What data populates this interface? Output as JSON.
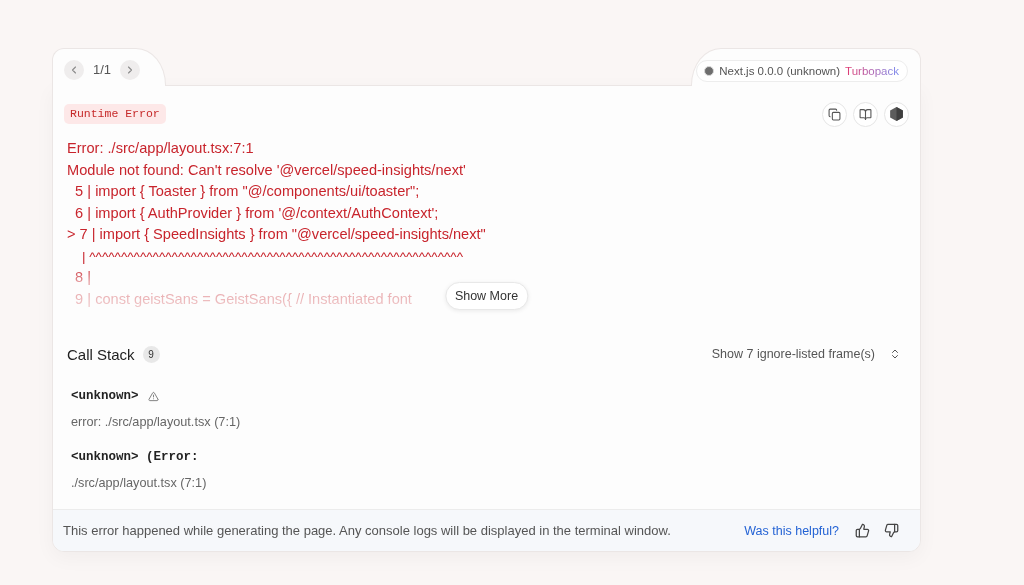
{
  "pager": {
    "position": "1/1"
  },
  "version": {
    "label": "Next.js 0.0.0 (unknown)",
    "bundler": "Turbopack"
  },
  "error": {
    "type": "Runtime Error",
    "title": "Error: ./src/app/layout.tsx:7:1",
    "message": "Module not found: Can't resolve '@vercel/speed-insights/next'",
    "code_lines": [
      "  5 | import { Toaster } from \"@/components/ui/toaster\";",
      "  6 | import { AuthProvider } from '@/context/AuthContext';",
      "> 7 | import { SpeedInsights } from \"@vercel/speed-insights/next\"",
      "    | ^^^^^^^^^^^^^^^^^^^^^^^^^^^^^^^^^^^^^^^^^^^^^^^^^^^^^^^^^^^",
      "  8 |",
      "  9 | const geistSans = GeistSans({ // Instantiated font"
    ],
    "expanded": false,
    "show_more": "Show More"
  },
  "call_stack": {
    "title": "Call Stack",
    "count": "9",
    "ignored_toggle": "Show 7 ignore-listed frame(s)",
    "frames": [
      {
        "name": "<unknown>",
        "warning": true,
        "location": "error: ./src/app/layout.tsx (7:1)"
      },
      {
        "name": "<unknown> (Error:",
        "warning": false,
        "location": "./src/app/layout.tsx (7:1)"
      }
    ]
  },
  "footer": {
    "note": "This error happened while generating the page. Any console logs will be displayed in the terminal window.",
    "feedback": "Was this helpful?"
  }
}
